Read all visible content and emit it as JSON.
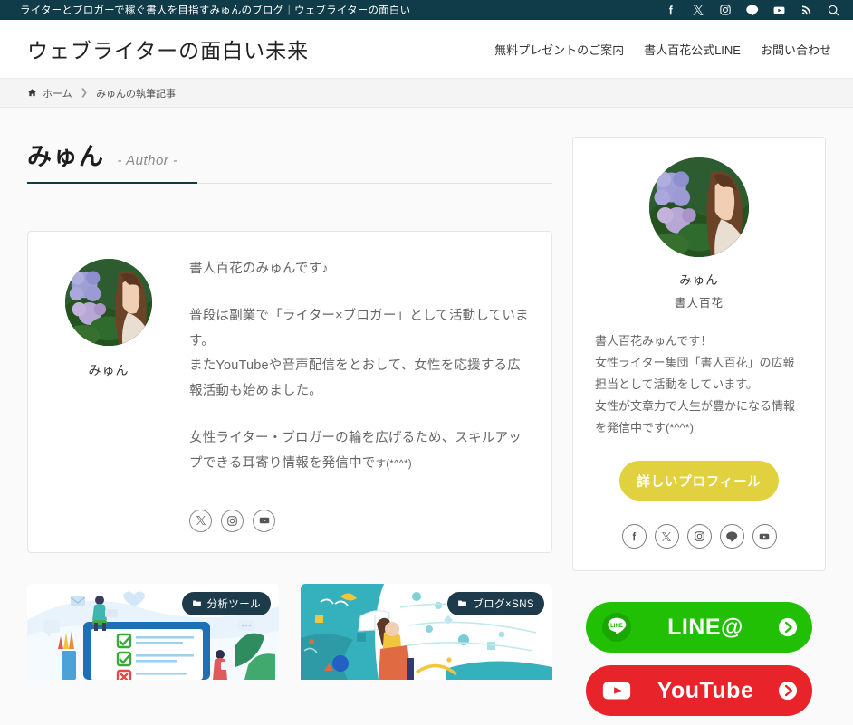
{
  "topbar": {
    "description": "ライターとブロガーで稼ぐ書人を目指すみゅんのブログ｜ウェブライターの面白い",
    "icons": [
      {
        "name": "facebook-icon",
        "label": "Facebook"
      },
      {
        "name": "x-twitter-icon",
        "label": "X"
      },
      {
        "name": "instagram-icon",
        "label": "Instagram"
      },
      {
        "name": "line-icon",
        "label": "LINE"
      },
      {
        "name": "youtube-icon",
        "label": "YouTube"
      },
      {
        "name": "rss-icon",
        "label": "RSS"
      },
      {
        "name": "search-icon",
        "label": "検索"
      }
    ]
  },
  "header": {
    "site_title": "ウェブライターの面白い未来",
    "nav": [
      {
        "label": "無料プレゼントのご案内"
      },
      {
        "label": "書人百花公式LINE"
      },
      {
        "label": "お問い合わせ"
      }
    ]
  },
  "breadcrumb": {
    "home": "ホーム",
    "separator": "❯",
    "current": "みゅんの執筆記事"
  },
  "page": {
    "heading": "みゅん",
    "subheading": "- Author -"
  },
  "author_card": {
    "avatar_name": "みゅん",
    "bio_paragraphs": [
      "書人百花のみゅんです♪",
      "普段は副業で「ライター×ブロガー」として活動しています。\nまたYouTubeや音声配信をとおして、女性を応援する広報活動も始めました。",
      "女性ライター・ブロガーの輪を広げるため、スキルアップできる耳寄り情報を発信中です(*^^*)"
    ],
    "bio_text_1": "書人百花のみゅんです♪",
    "bio_text_2": "普段は副業で「ライター×ブロガー」として活動しています。",
    "bio_text_3": "またYouTubeや音声配信をとおして、女性を応援する広報活動も始めました。",
    "bio_text_4": "女性ライター・ブロガーの輪を広げるため、スキルアップできる耳寄り情報を発信中で",
    "bio_text_5": "す(*^^*)",
    "social": [
      {
        "name": "x-twitter-icon",
        "label": "X"
      },
      {
        "name": "instagram-icon",
        "label": "Instagram"
      },
      {
        "name": "youtube-icon",
        "label": "YouTube"
      }
    ]
  },
  "sidebar": {
    "profile": {
      "name": "みゅん",
      "role": "書人百花",
      "bio_line_1": "書人百花みゅんです！",
      "bio_line_2": "女性ライター集団「書人百花」の広報担当として活動をしています。",
      "bio_line_3": "女性が文章力で人生が豊かになる情報を発信中です(*^^*)",
      "button_label": "詳しいプロフィール",
      "social": [
        {
          "name": "facebook-icon",
          "label": "Facebook"
        },
        {
          "name": "x-twitter-icon",
          "label": "X"
        },
        {
          "name": "instagram-icon",
          "label": "Instagram"
        },
        {
          "name": "line-icon",
          "label": "LINE"
        },
        {
          "name": "youtube-icon",
          "label": "YouTube"
        }
      ]
    },
    "banners": [
      {
        "name": "line-banner",
        "text": "LINE@",
        "color": "#21c004"
      },
      {
        "name": "youtube-banner",
        "text": "YouTube",
        "color": "#e8232a"
      }
    ]
  },
  "article_cards": [
    {
      "category": "分析ツール"
    },
    {
      "category": "ブログ×SNS"
    }
  ],
  "colors": {
    "topbar_bg": "#103b48",
    "page_bg": "#fafafa",
    "accent_button": "#e2d13e",
    "badge_bg": "#1d3b4a",
    "line_green": "#21c004",
    "youtube_red": "#e8232a"
  }
}
